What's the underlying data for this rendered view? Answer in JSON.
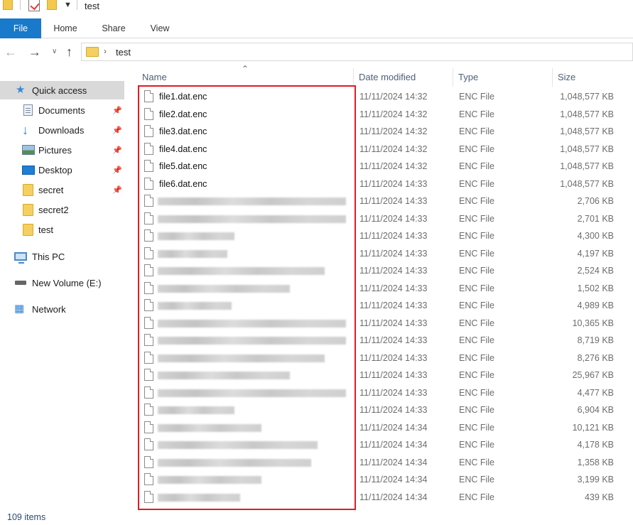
{
  "window": {
    "title": "test"
  },
  "ribbon": {
    "tabs": [
      "File",
      "Home",
      "Share",
      "View"
    ]
  },
  "address": {
    "path_segment": "test"
  },
  "sidebar": {
    "items": [
      {
        "label": "Quick access",
        "icon": "star-icon",
        "selected": true,
        "pinned": false
      },
      {
        "label": "Documents",
        "icon": "documents-icon",
        "pinned": true
      },
      {
        "label": "Downloads",
        "icon": "downloads-icon",
        "pinned": true
      },
      {
        "label": "Pictures",
        "icon": "pictures-icon",
        "pinned": true
      },
      {
        "label": "Desktop",
        "icon": "desktop-icon",
        "pinned": true
      },
      {
        "label": "secret",
        "icon": "folder-icon",
        "pinned": true
      },
      {
        "label": "secret2",
        "icon": "folder-icon",
        "pinned": false
      },
      {
        "label": "test",
        "icon": "folder-icon",
        "pinned": false
      },
      {
        "label": "This PC",
        "icon": "computer-icon",
        "pinned": false
      },
      {
        "label": "New Volume (E:)",
        "icon": "drive-icon",
        "pinned": false
      },
      {
        "label": "Network",
        "icon": "network-icon",
        "pinned": false
      }
    ]
  },
  "columns": {
    "name": "Name",
    "date": "Date modified",
    "type": "Type",
    "size": "Size"
  },
  "files": [
    {
      "name": "file1.dat.enc",
      "date": "11/11/2024 14:32",
      "type": "ENC File",
      "size": "1,048,577 KB"
    },
    {
      "name": "file2.dat.enc",
      "date": "11/11/2024 14:32",
      "type": "ENC File",
      "size": "1,048,577 KB"
    },
    {
      "name": "file3.dat.enc",
      "date": "11/11/2024 14:32",
      "type": "ENC File",
      "size": "1,048,577 KB"
    },
    {
      "name": "file4.dat.enc",
      "date": "11/11/2024 14:32",
      "type": "ENC File",
      "size": "1,048,577 KB"
    },
    {
      "name": "file5.dat.enc",
      "date": "11/11/2024 14:32",
      "type": "ENC File",
      "size": "1,048,577 KB"
    },
    {
      "name": "file6.dat.enc",
      "date": "11/11/2024 14:33",
      "type": "ENC File",
      "size": "1,048,577 KB"
    },
    {
      "name": "",
      "date": "11/11/2024 14:33",
      "type": "ENC File",
      "size": "2,706 KB"
    },
    {
      "name": "",
      "date": "11/11/2024 14:33",
      "type": "ENC File",
      "size": "2,701 KB"
    },
    {
      "name": "",
      "date": "11/11/2024 14:33",
      "type": "ENC File",
      "size": "4,300 KB"
    },
    {
      "name": "",
      "date": "11/11/2024 14:33",
      "type": "ENC File",
      "size": "4,197 KB"
    },
    {
      "name": "",
      "date": "11/11/2024 14:33",
      "type": "ENC File",
      "size": "2,524 KB"
    },
    {
      "name": "",
      "date": "11/11/2024 14:33",
      "type": "ENC File",
      "size": "1,502 KB"
    },
    {
      "name": "",
      "date": "11/11/2024 14:33",
      "type": "ENC File",
      "size": "4,989 KB"
    },
    {
      "name": "",
      "date": "11/11/2024 14:33",
      "type": "ENC File",
      "size": "10,365 KB"
    },
    {
      "name": "",
      "date": "11/11/2024 14:33",
      "type": "ENC File",
      "size": "8,719 KB"
    },
    {
      "name": "",
      "date": "11/11/2024 14:33",
      "type": "ENC File",
      "size": "8,276 KB"
    },
    {
      "name": "",
      "date": "11/11/2024 14:33",
      "type": "ENC File",
      "size": "25,967 KB"
    },
    {
      "name": "",
      "date": "11/11/2024 14:33",
      "type": "ENC File",
      "size": "4,477 KB"
    },
    {
      "name": "",
      "date": "11/11/2024 14:33",
      "type": "ENC File",
      "size": "6,904 KB"
    },
    {
      "name": "",
      "date": "11/11/2024 14:34",
      "type": "ENC File",
      "size": "10,121 KB"
    },
    {
      "name": "",
      "date": "11/11/2024 14:34",
      "type": "ENC File",
      "size": "4,178 KB"
    },
    {
      "name": "",
      "date": "11/11/2024 14:34",
      "type": "ENC File",
      "size": "1,358 KB"
    },
    {
      "name": "",
      "date": "11/11/2024 14:34",
      "type": "ENC File",
      "size": "3,199 KB"
    },
    {
      "name": "",
      "date": "11/11/2024 14:34",
      "type": "ENC File",
      "size": "439 KB"
    }
  ],
  "status": {
    "item_count": "109 items"
  },
  "colors": {
    "file_tab": "#1979ca",
    "highlight": "#e11b24",
    "selected_nav": "#d9d9d9"
  }
}
